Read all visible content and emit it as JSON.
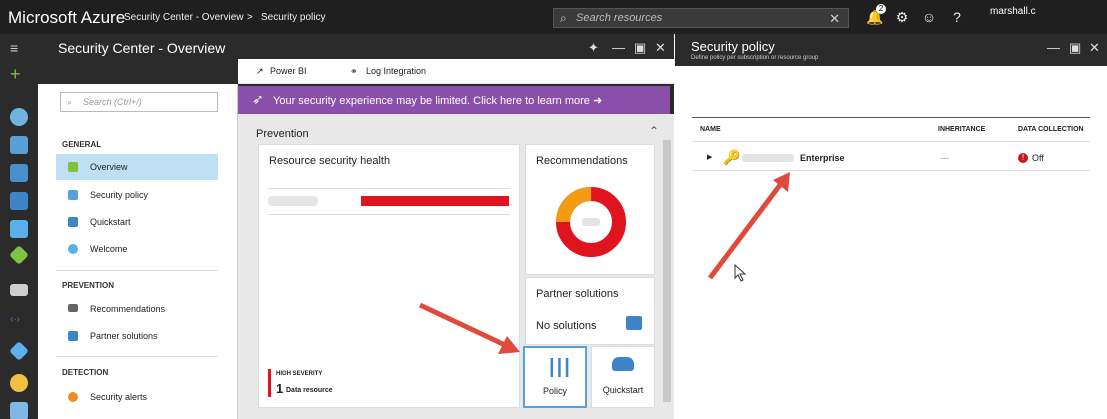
{
  "topbar": {
    "brand": "Microsoft Azure",
    "crumbs": [
      "Security Center - Overview",
      ">",
      "Security policy"
    ],
    "search_placeholder": "Search resources",
    "notification_count": "2",
    "user": "marshall.c"
  },
  "blade_overview": {
    "title": "Security Center - Overview",
    "toolbar": [
      "Power BI",
      "Log Integration"
    ],
    "search_placeholder": "Search (Ctrl+/)",
    "sections": [
      {
        "label": "GENERAL",
        "items": [
          "Overview",
          "Security policy",
          "Quickstart",
          "Welcome"
        ]
      },
      {
        "label": "PREVENTION",
        "items": [
          "Recommendations",
          "Partner solutions"
        ]
      },
      {
        "label": "DETECTION",
        "items": [
          "Security alerts"
        ]
      }
    ],
    "active_item": "Overview",
    "banner": "Your security experience may be limited. Click here to learn more ➜",
    "prevention_label": "Prevention",
    "tiles": {
      "resource_health_title": "Resource security health",
      "recommendations_title": "Recommendations",
      "partner_title": "Partner solutions",
      "partner_value": "No solutions",
      "severity_label": "HIGH SEVERITY",
      "severity_count": "1",
      "severity_unit": "Data resource",
      "policy_label": "Policy",
      "quickstart_label": "Quickstart"
    },
    "colors": {
      "banner": "#8a4faa",
      "severity": "#e0141e",
      "donut_orange": "#f39c12"
    }
  },
  "blade_policy": {
    "title": "Security policy",
    "subtitle": "Define policy per subscription or resource group",
    "columns": [
      "NAME",
      "INHERITANCE",
      "DATA COLLECTION"
    ],
    "rows": [
      {
        "name": "Enterprise",
        "inheritance": "---",
        "data_collection": "Off"
      }
    ]
  }
}
